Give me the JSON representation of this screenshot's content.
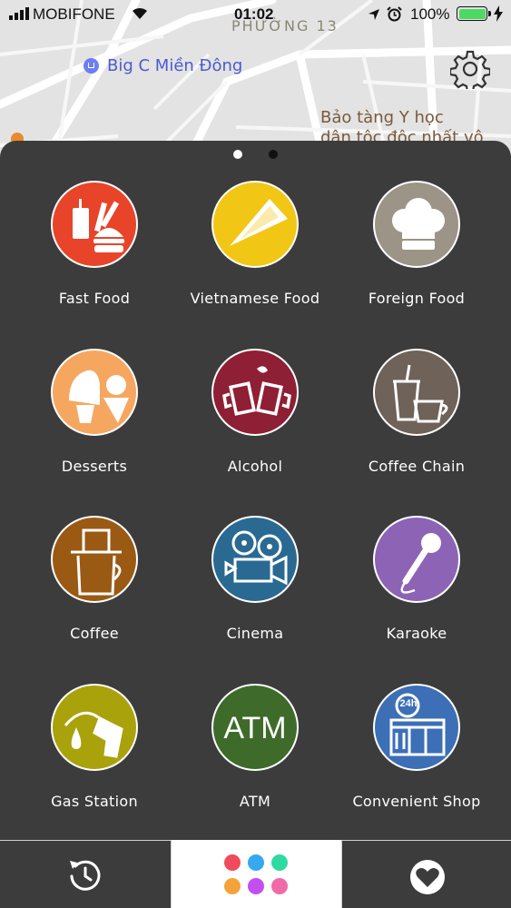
{
  "status_bar": {
    "carrier": "MOBIFONE",
    "time": "01:02",
    "battery": "100%"
  },
  "map": {
    "poi_name": "Big C Miền Đông",
    "area_label": "PHƯỜNG 13",
    "museum_line1": "Bảo tàng Y học",
    "museum_line2": "dân tộc độc nhất vô"
  },
  "categories": [
    {
      "label": "Fast Food",
      "color": "#e8442a",
      "icon": "burger-fries-icon"
    },
    {
      "label": "Vietnamese Food",
      "color": "#f2c614",
      "icon": "conical-hat-icon"
    },
    {
      "label": "Foreign Food",
      "color": "#9b9487",
      "icon": "chef-hat-icon"
    },
    {
      "label": "Desserts",
      "color": "#f5a760",
      "icon": "dessert-icon"
    },
    {
      "label": "Alcohol",
      "color": "#8e1f35",
      "icon": "beer-mugs-icon"
    },
    {
      "label": "Coffee Chain",
      "color": "#6e6259",
      "icon": "coffee-cups-icon"
    },
    {
      "label": "Coffee",
      "color": "#9a5a14",
      "icon": "coffee-filter-icon"
    },
    {
      "label": "Cinema",
      "color": "#2a6a92",
      "icon": "film-camera-icon"
    },
    {
      "label": "Karaoke",
      "color": "#8d63b6",
      "icon": "microphone-icon"
    },
    {
      "label": "Gas Station",
      "color": "#a9a20a",
      "icon": "fuel-nozzle-icon"
    },
    {
      "label": "ATM",
      "color": "#3e6b2a",
      "icon": "atm-icon",
      "icon_text": "ATM"
    },
    {
      "label": "Convenient Shop",
      "color": "#3c6fb6",
      "icon": "shop-24h-icon",
      "icon_text": "24h"
    }
  ],
  "pager": {
    "pages": 2,
    "current": 1
  },
  "tabbar": {
    "left": "history-icon",
    "middle": "categories-dots-icon",
    "right": "favorites-heart-icon",
    "dot_colors": [
      "#ef4b5a",
      "#35a8f0",
      "#2fd9a2",
      "#f5a23c",
      "#c44ff0",
      "#f06aa8"
    ]
  }
}
